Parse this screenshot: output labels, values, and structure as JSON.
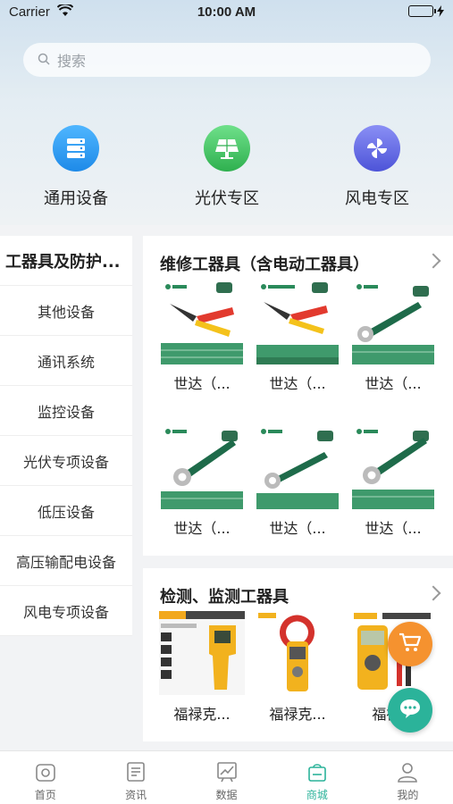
{
  "status": {
    "carrier": "Carrier",
    "time": "10:00 AM"
  },
  "search": {
    "placeholder": "搜索"
  },
  "categories": [
    {
      "label": "通用设备",
      "icon": "server-icon",
      "color": "#2b9af3"
    },
    {
      "label": "光伏专区",
      "icon": "solar-panel-icon",
      "color": "#3cc15a"
    },
    {
      "label": "风电专区",
      "icon": "pinwheel-icon",
      "color": "#5b63e6"
    }
  ],
  "sidebar": {
    "items": [
      {
        "label": "工器具及防护..."
      },
      {
        "label": "其他设备"
      },
      {
        "label": "通讯系统"
      },
      {
        "label": "监控设备"
      },
      {
        "label": "光伏专项设备"
      },
      {
        "label": "低压设备"
      },
      {
        "label": "高压输配电设备"
      },
      {
        "label": "风电专项设备"
      }
    ]
  },
  "sections": [
    {
      "title": "维修工器具（含电动工器具）",
      "products": [
        {
          "name": "世达（..."
        },
        {
          "name": "世达（..."
        },
        {
          "name": "世达（..."
        },
        {
          "name": "世达（..."
        },
        {
          "name": "世达（..."
        },
        {
          "name": "世达（..."
        }
      ]
    },
    {
      "title": "检测、监测工器具",
      "products": [
        {
          "name": "福禄克..."
        },
        {
          "name": "福禄克..."
        },
        {
          "name": "福禄..."
        }
      ]
    }
  ],
  "tabbar": {
    "items": [
      {
        "label": "首页"
      },
      {
        "label": "资讯"
      },
      {
        "label": "数据"
      },
      {
        "label": "商城"
      },
      {
        "label": "我的"
      }
    ],
    "active_color": "#2bb39a"
  },
  "fab": {
    "cart_color": "#f5922f",
    "chat_color": "#2bb39a"
  }
}
